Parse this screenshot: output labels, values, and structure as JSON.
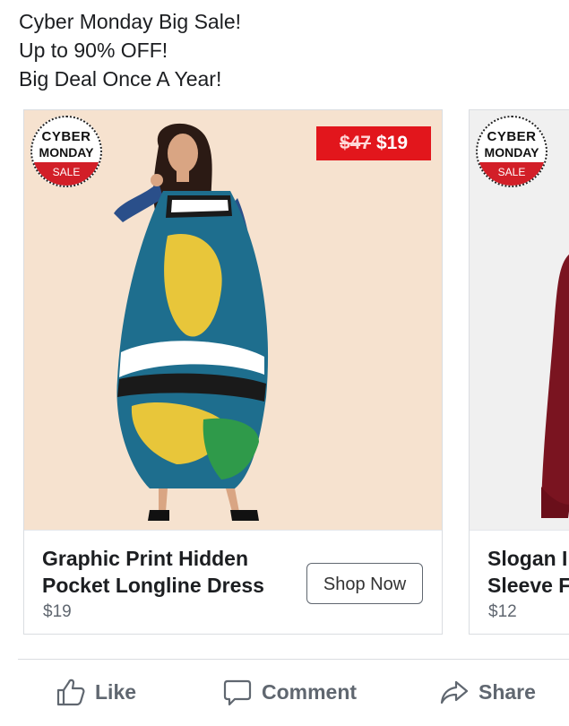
{
  "post": {
    "lines": [
      "Cyber Monday Big Sale!",
      "Up to 90% OFF!",
      "Big Deal Once A Year!"
    ]
  },
  "badge": {
    "line1": "CYBER",
    "line2": "MONDAY",
    "line3": "SALE"
  },
  "cards": [
    {
      "old_price": "$47",
      "new_price": "$19",
      "title_line1": "Graphic Print Hidden",
      "title_line2": "Pocket Longline Dress",
      "price": "$19",
      "button": "Shop Now",
      "image": "woman-in-colorful-print-dress"
    },
    {
      "title_line1": "Slogan I",
      "title_line2": "Sleeve F",
      "price": "$12",
      "image": "burgundy-sweatshirt"
    }
  ],
  "actions": {
    "like": "Like",
    "comment": "Comment",
    "share": "Share"
  },
  "colors": {
    "sale_red": "#e2161c",
    "text": "#1c1e21",
    "muted": "#606770"
  }
}
